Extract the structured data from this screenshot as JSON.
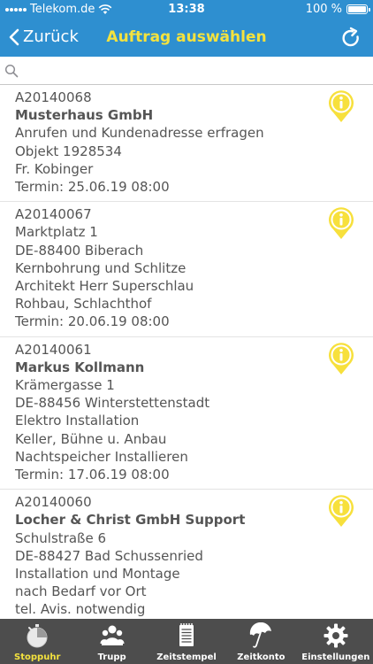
{
  "status_bar": {
    "carrier": "Telekom.de",
    "time": "13:38",
    "battery": "100 %"
  },
  "nav": {
    "back_label": "Zurück",
    "title": "Auftrag auswählen"
  },
  "search": {
    "value": "",
    "placeholder": ""
  },
  "orders": [
    {
      "id": "A20140068",
      "name": "Musterhaus GmbH",
      "lines": [
        "Anrufen und Kundenadresse erfragen",
        "Objekt 1928534",
        "Fr. Kobinger"
      ],
      "termin": "Termin: 25.06.19 08:00"
    },
    {
      "id": "A20140067",
      "name": "",
      "lines": [
        "Marktplatz 1",
        "DE-88400 Biberach",
        "Kernbohrung und Schlitze",
        "Architekt Herr Superschlau",
        "Rohbau, Schlachthof"
      ],
      "termin": "Termin: 20.06.19 08:00"
    },
    {
      "id": "A20140061",
      "name": "Markus Kollmann",
      "lines": [
        "Krämergasse 1",
        "DE-88456 Winterstettenstadt",
        "Elektro Installation",
        "Keller, Bühne u. Anbau",
        "Nachtspeicher Installieren"
      ],
      "termin": "Termin: 17.06.19 08:00"
    },
    {
      "id": "A20140060",
      "name": "Locher & Christ GmbH Support",
      "lines": [
        "Schulstraße 6",
        "DE-88427 Bad Schussenried",
        "Installation und Montage",
        "nach Bedarf vor Ort",
        "tel. Avis. notwendig"
      ],
      "termin": ""
    }
  ],
  "tabs": [
    {
      "label": "Stoppuhr",
      "icon": "stopwatch-icon",
      "active": true
    },
    {
      "label": "Trupp",
      "icon": "team-icon",
      "active": false
    },
    {
      "label": "Zeitstempel",
      "icon": "notepad-icon",
      "active": false
    },
    {
      "label": "Zeitkonto",
      "icon": "umbrella-icon",
      "active": false
    },
    {
      "label": "Einstellungen",
      "icon": "gear-icon",
      "active": false
    }
  ],
  "colors": {
    "header_blue": "#2e8fd0",
    "title_yellow": "#f4e23e",
    "info_yellow": "#f7e03c",
    "tabbar_gray": "#4d4d4d",
    "text_gray": "#555555"
  }
}
